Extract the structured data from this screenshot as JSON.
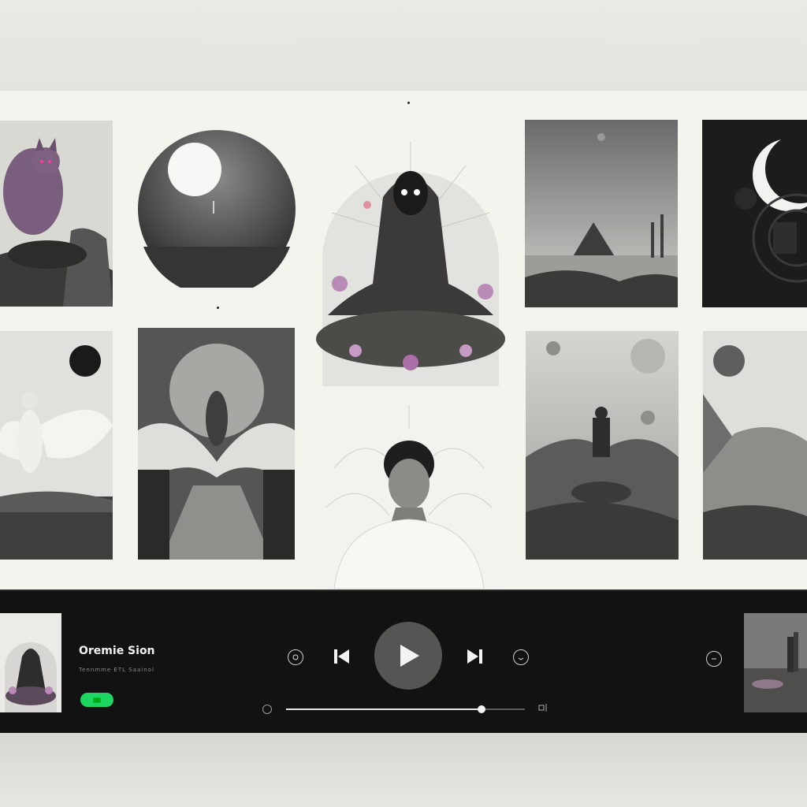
{
  "now_playing": {
    "title": "Oremie Sion",
    "subtitle": "Tennmme ETL Saainol"
  },
  "playback": {
    "progress_fraction": 0.82
  },
  "icons": {
    "previous": "skip-previous-icon",
    "play": "play-icon",
    "next": "skip-next-icon",
    "left_control": "emoji-circle-icon",
    "right_control": "download-circle-icon",
    "far_right": "menu-circle-icon",
    "time_left": "time-dot-icon",
    "time_right": "volume-icon"
  },
  "colors": {
    "player_bg": "#121212",
    "accent_green": "#1ed760",
    "canvas_bg": "#f4f4ef"
  }
}
